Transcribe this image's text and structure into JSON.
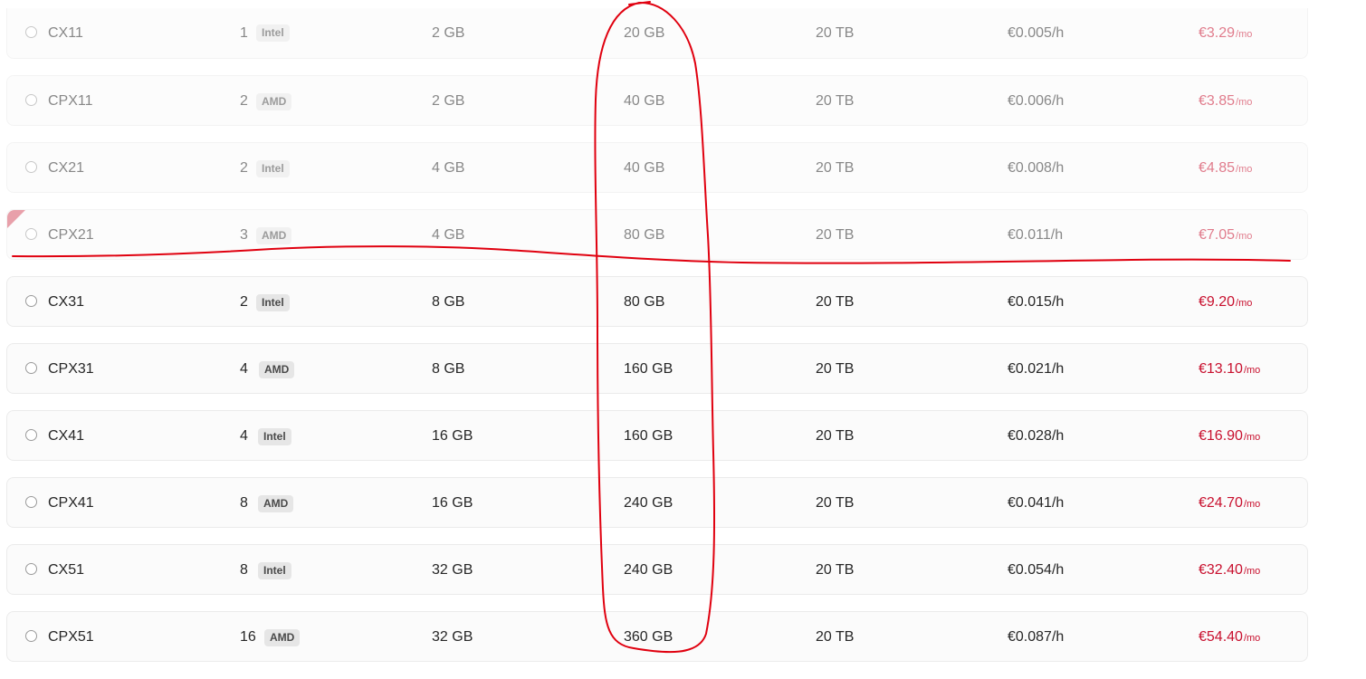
{
  "colors": {
    "price_month": "#c8102e",
    "annotation": "#e0000f",
    "corner_ribbon": "#d65466"
  },
  "plans": [
    {
      "name": "CX11",
      "vcpu": "1",
      "cpu": "Intel",
      "ram": "2 GB",
      "ssd": "20 GB",
      "traffic": "20 TB",
      "hourly": "€0.005/h",
      "monthly": "€3.29",
      "unit": "/mo",
      "disabled": true
    },
    {
      "name": "CPX11",
      "vcpu": "2",
      "cpu": "AMD",
      "ram": "2 GB",
      "ssd": "40 GB",
      "traffic": "20 TB",
      "hourly": "€0.006/h",
      "monthly": "€3.85",
      "unit": "/mo",
      "disabled": true
    },
    {
      "name": "CX21",
      "vcpu": "2",
      "cpu": "Intel",
      "ram": "4 GB",
      "ssd": "40 GB",
      "traffic": "20 TB",
      "hourly": "€0.008/h",
      "monthly": "€4.85",
      "unit": "/mo",
      "disabled": true
    },
    {
      "name": "CPX21",
      "vcpu": "3",
      "cpu": "AMD",
      "ram": "4 GB",
      "ssd": "80 GB",
      "traffic": "20 TB",
      "hourly": "€0.011/h",
      "monthly": "€7.05",
      "unit": "/mo",
      "disabled": true
    },
    {
      "name": "CX31",
      "vcpu": "2",
      "cpu": "Intel",
      "ram": "8 GB",
      "ssd": "80 GB",
      "traffic": "20 TB",
      "hourly": "€0.015/h",
      "monthly": "€9.20",
      "unit": "/mo",
      "disabled": false
    },
    {
      "name": "CPX31",
      "vcpu": "4",
      "cpu": "AMD",
      "ram": "8 GB",
      "ssd": "160 GB",
      "traffic": "20 TB",
      "hourly": "€0.021/h",
      "monthly": "€13.10",
      "unit": "/mo",
      "disabled": false
    },
    {
      "name": "CX41",
      "vcpu": "4",
      "cpu": "Intel",
      "ram": "16 GB",
      "ssd": "160 GB",
      "traffic": "20 TB",
      "hourly": "€0.028/h",
      "monthly": "€16.90",
      "unit": "/mo",
      "disabled": false
    },
    {
      "name": "CPX41",
      "vcpu": "8",
      "cpu": "AMD",
      "ram": "16 GB",
      "ssd": "240 GB",
      "traffic": "20 TB",
      "hourly": "€0.041/h",
      "monthly": "€24.70",
      "unit": "/mo",
      "disabled": false
    },
    {
      "name": "CX51",
      "vcpu": "8",
      "cpu": "Intel",
      "ram": "32 GB",
      "ssd": "240 GB",
      "traffic": "20 TB",
      "hourly": "€0.054/h",
      "monthly": "€32.40",
      "unit": "/mo",
      "disabled": false
    },
    {
      "name": "CPX51",
      "vcpu": "16",
      "cpu": "AMD",
      "ram": "32 GB",
      "ssd": "360 GB",
      "traffic": "20 TB",
      "hourly": "€0.087/h",
      "monthly": "€54.40",
      "unit": "/mo",
      "disabled": false
    }
  ]
}
